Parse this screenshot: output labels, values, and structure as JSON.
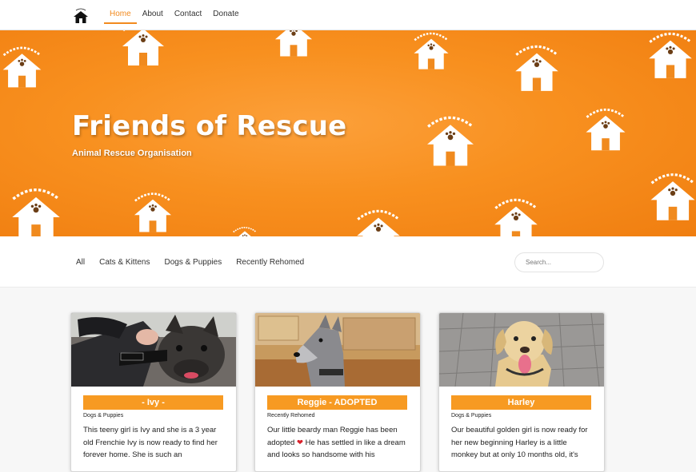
{
  "nav": {
    "logo_icon": "house-logo-icon",
    "links": [
      {
        "label": "Home",
        "active": true
      },
      {
        "label": "About",
        "active": false
      },
      {
        "label": "Contact",
        "active": false
      },
      {
        "label": "Donate",
        "active": false
      }
    ]
  },
  "hero": {
    "title": "Friends of Rescue",
    "subtitle": "Animal Rescue Organisation",
    "background_color": "#f8901f",
    "pattern_icon": "friends-of-rescue-house-logo"
  },
  "filters": {
    "items": [
      "All",
      "Cats & Kittens",
      "Dogs & Puppies",
      "Recently Rehomed"
    ],
    "search_placeholder": "Search..."
  },
  "accent_color": "#f79a22",
  "cards": [
    {
      "name": "- Ivy -",
      "category": "Dogs & Puppies",
      "description": "This teeny girl is Ivy and she is a 3 year old Frenchie Ivy is now ready to find her forever home. She is such an",
      "photo": "dark french bulldog with harness"
    },
    {
      "name": "Reggie - ADOPTED",
      "category": "Recently Rehomed",
      "description_before": "Our little beardy man Reggie has been adopted",
      "description_after": "He has settled in like a dream and looks so handsome with his",
      "photo": "grey schnauzer in kitchen"
    },
    {
      "name": "Harley",
      "category": "Dogs & Puppies",
      "description": "Our beautiful golden girl is now ready for her new beginning Harley is a little monkey but at only 10 months old, it's",
      "photo": "yellow labrador puppy on patio"
    }
  ]
}
